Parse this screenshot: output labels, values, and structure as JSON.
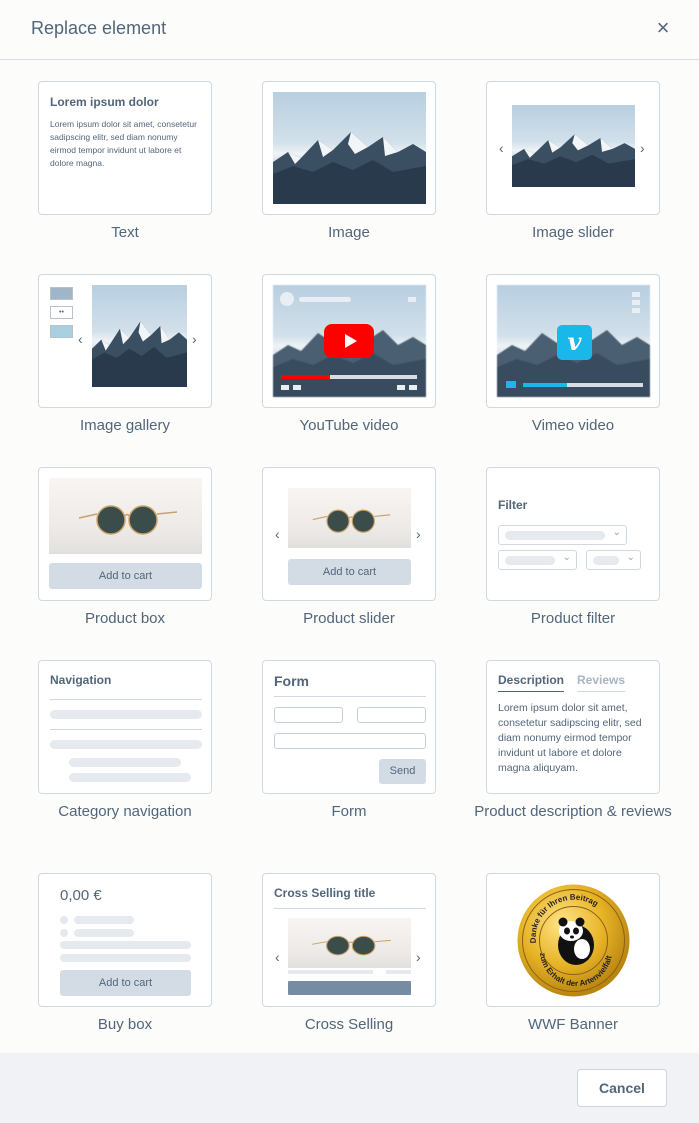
{
  "dialog": {
    "title": "Replace element",
    "close_icon": "close-icon",
    "cancel_label": "Cancel"
  },
  "elements": [
    {
      "label": "Text"
    },
    {
      "label": "Image"
    },
    {
      "label": "Image slider"
    },
    {
      "label": "Image gallery"
    },
    {
      "label": "YouTube video"
    },
    {
      "label": "Vimeo video"
    },
    {
      "label": "Product box"
    },
    {
      "label": "Product slider"
    },
    {
      "label": "Product filter"
    },
    {
      "label": "Category navigation"
    },
    {
      "label": "Form"
    },
    {
      "label": "Product description & reviews"
    },
    {
      "label": "Buy box"
    },
    {
      "label": "Cross Selling"
    },
    {
      "label": "WWF Banner"
    }
  ],
  "previews": {
    "text": {
      "heading": "Lorem ipsum dolor",
      "body": "Lorem ipsum dolor sit amet, consetetur sadipscing elitr, sed diam nonumy eirmod tempor invidunt ut labore et dolore magna."
    },
    "product_box": {
      "button": "Add to cart"
    },
    "product_slider": {
      "button": "Add to cart"
    },
    "product_filter": {
      "heading": "Filter"
    },
    "category_navigation": {
      "heading": "Navigation"
    },
    "form": {
      "heading": "Form",
      "button": "Send"
    },
    "description_reviews": {
      "tab_description": "Description",
      "tab_reviews": "Reviews",
      "body": "Lorem ipsum dolor sit amet, consetetur sadipscing elitr, sed diam nonumy eirmod tempor invidunt ut labore et dolore magna aliquyam."
    },
    "buy_box": {
      "price": "0,00 €",
      "button": "Add to cart"
    },
    "cross_selling": {
      "heading": "Cross Selling title"
    },
    "wwf": {
      "seal_text": "Danke für Ihren Beitrag zum Erhalt der Artenvielfalt"
    }
  },
  "colors": {
    "youtube_red": "#ff0000",
    "vimeo_blue": "#1ab7ea",
    "accent_blue": "#758ca3",
    "wwf_gold": "#d9a21c"
  }
}
